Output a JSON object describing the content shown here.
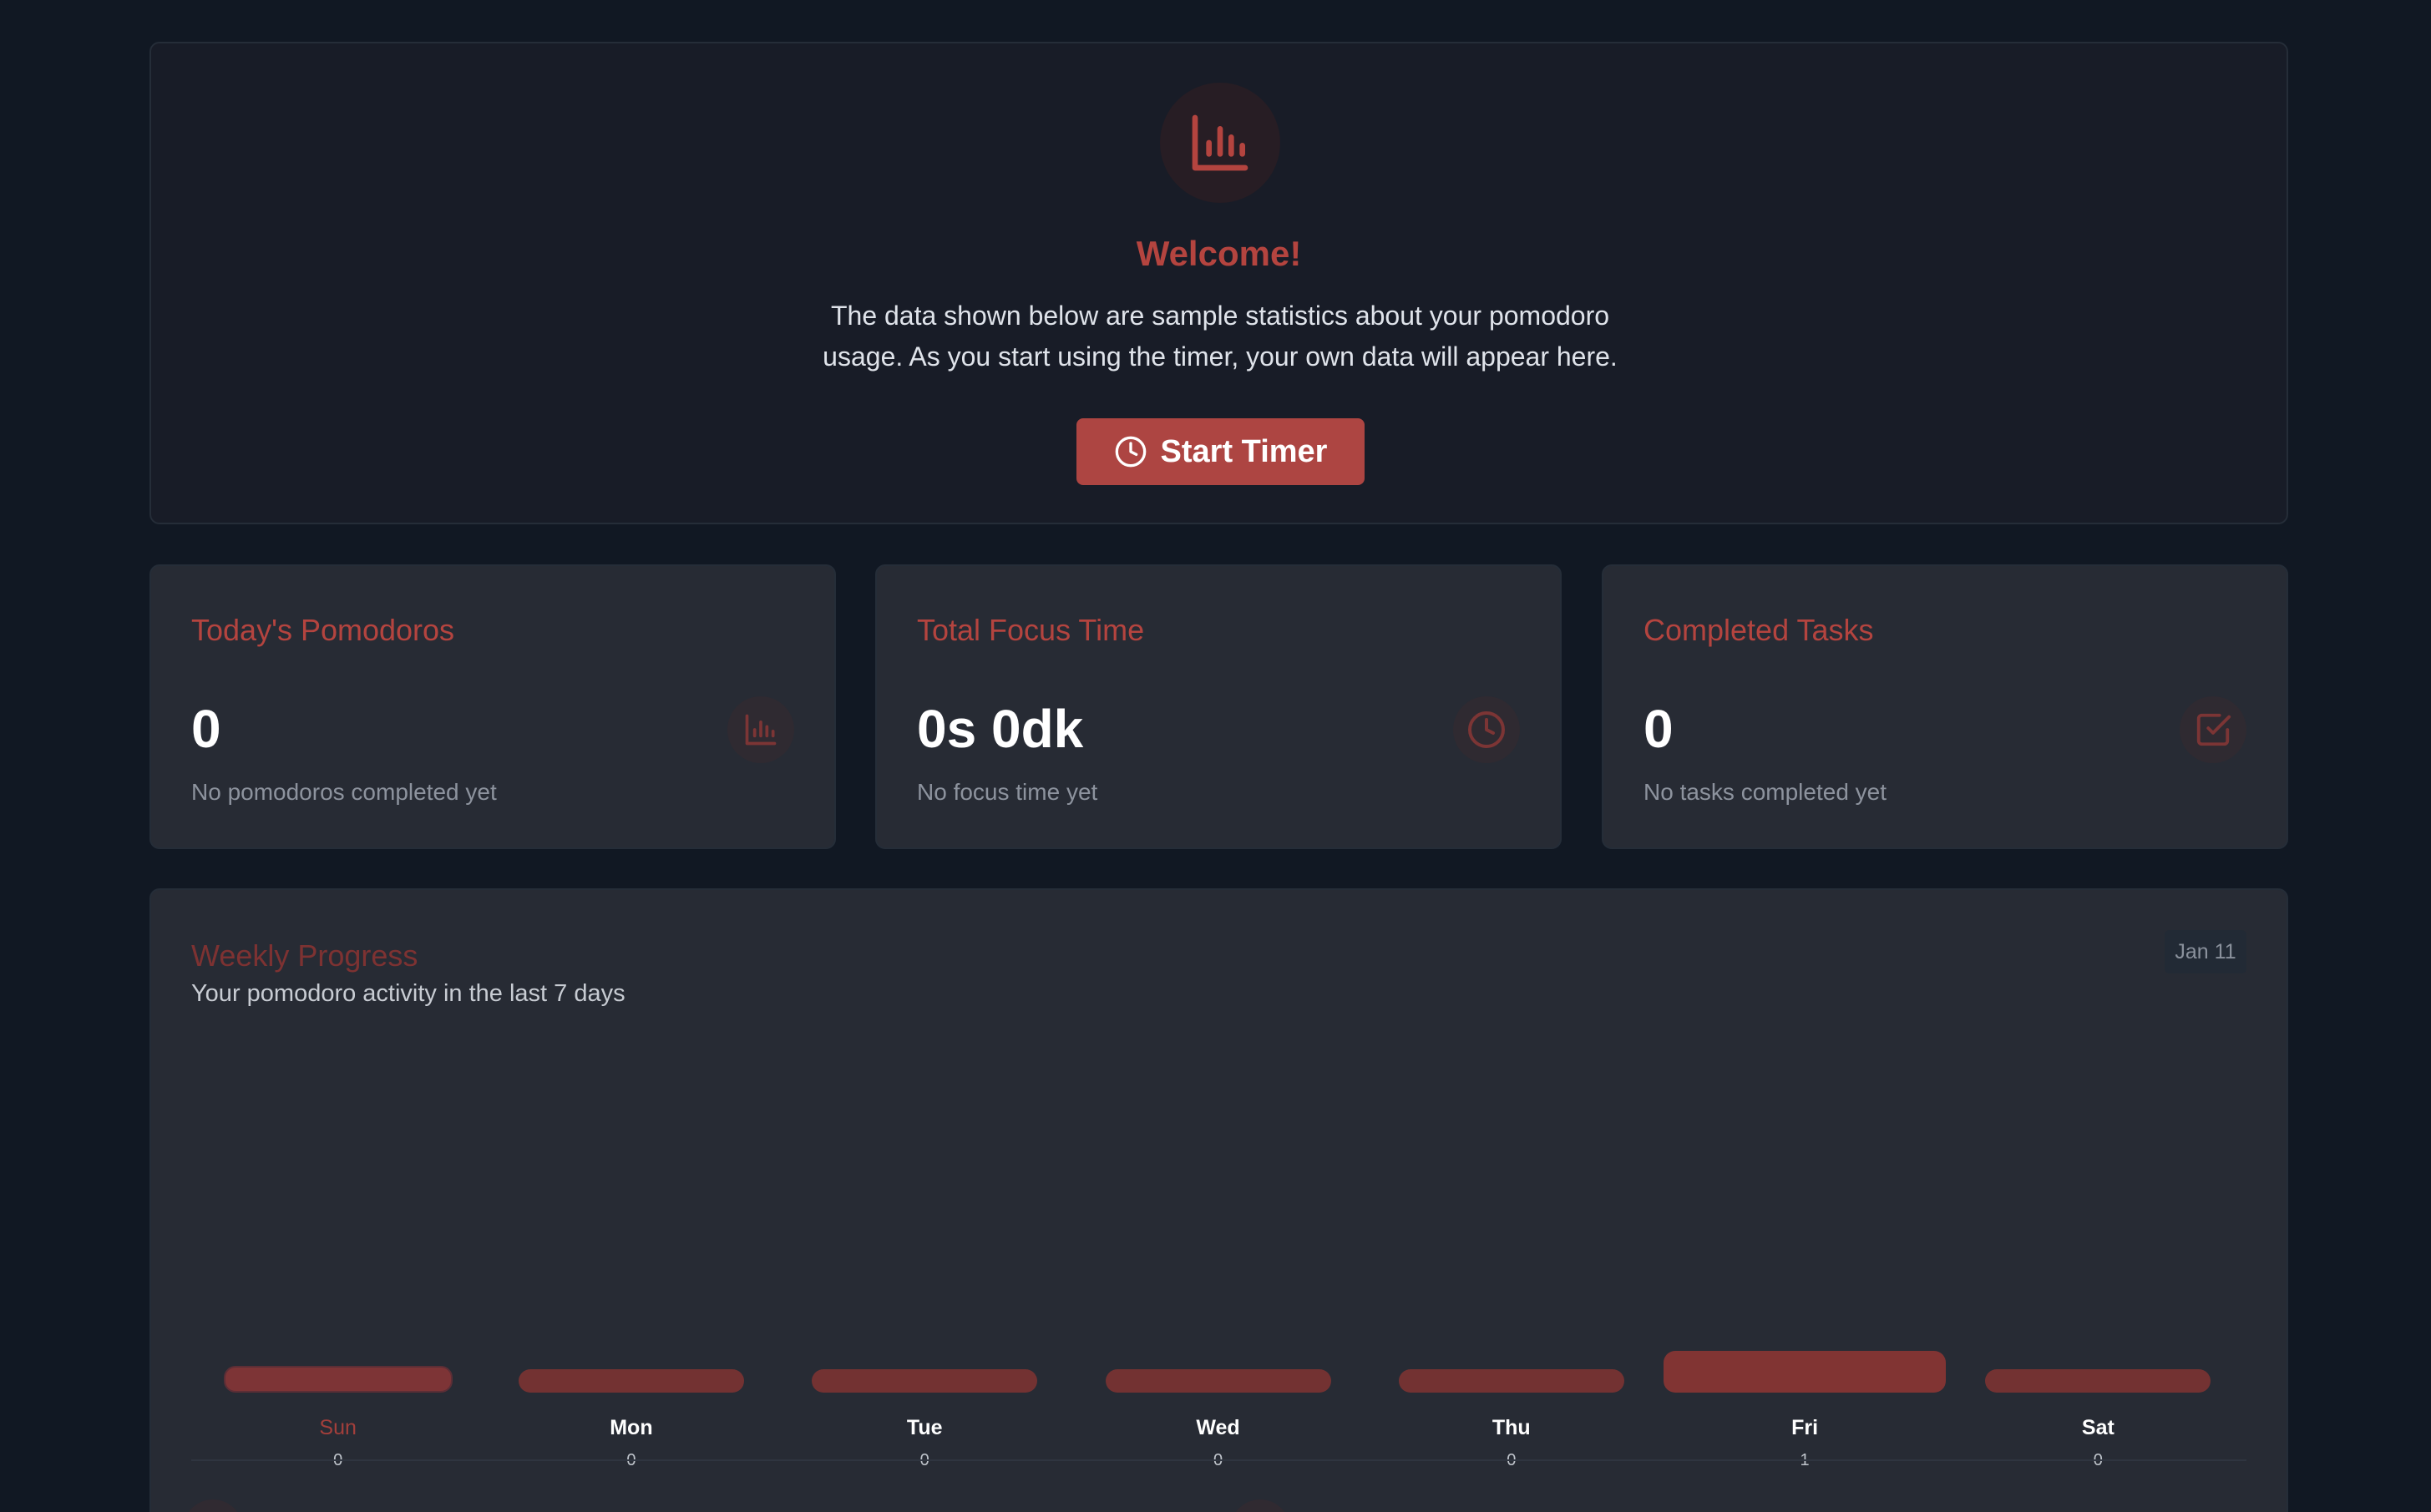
{
  "welcome": {
    "title": "Welcome!",
    "text": "The data shown below are sample statistics about your pomodoro usage. As you start using the timer, your own data will appear here.",
    "button_label": "Start Timer",
    "icon": "bar-chart-icon"
  },
  "stats": [
    {
      "title": "Today's Pomodoros",
      "value": "0",
      "subtitle": "No pomodoros completed yet",
      "icon": "bar-chart-icon"
    },
    {
      "title": "Total Focus Time",
      "value": "0s 0dk",
      "subtitle": "No focus time yet",
      "icon": "clock-icon"
    },
    {
      "title": "Completed Tasks",
      "value": "0",
      "subtitle": "No tasks completed yet",
      "icon": "check-square-icon"
    }
  ],
  "weekly": {
    "title": "Weekly Progress",
    "subtitle": "Your pomodoro activity in the last 7 days",
    "date_badge": "Jan 11",
    "days": [
      {
        "label": "Sun",
        "count": "0",
        "value": 0,
        "today": true
      },
      {
        "label": "Mon",
        "count": "0",
        "value": 0,
        "today": false
      },
      {
        "label": "Tue",
        "count": "0",
        "value": 0,
        "today": false
      },
      {
        "label": "Wed",
        "count": "0",
        "value": 0,
        "today": false
      },
      {
        "label": "Thu",
        "count": "0",
        "value": 0,
        "today": false
      },
      {
        "label": "Fri",
        "count": "1",
        "value": 1,
        "today": false
      },
      {
        "label": "Sat",
        "count": "0",
        "value": 0,
        "today": false
      }
    ]
  },
  "colors": {
    "accent": "#ad4542",
    "background": "#111823",
    "card": "#272b34",
    "bar": "#733232"
  }
}
